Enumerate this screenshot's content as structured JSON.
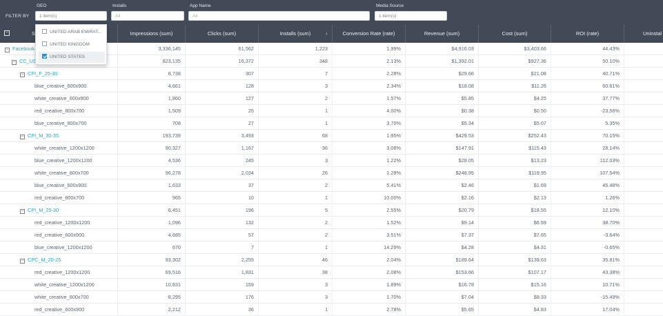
{
  "filter_bar": {
    "label": "FILTER BY",
    "filters": [
      {
        "title": "GEO",
        "value": "1 item(s)",
        "placeholder": ""
      },
      {
        "title": "Installs",
        "value": "",
        "placeholder": "All"
      },
      {
        "title": "App Name",
        "value": "",
        "placeholder": "All"
      },
      {
        "title": "Media Source",
        "value": "1 item(s)",
        "placeholder": ""
      }
    ]
  },
  "geo_dropdown": {
    "options": [
      {
        "label": "UNITED ARAB EMIRAT...",
        "checked": false
      },
      {
        "label": "UNITED KINGDOM",
        "checked": false
      },
      {
        "label": "UNITED STATES",
        "checked": true
      }
    ]
  },
  "table": {
    "expand_all_icon": "minus-square-icon",
    "sort_icon": "arrow-down-icon",
    "columns": {
      "name": "S",
      "impressions": "Impressions (sum)",
      "clicks": "Clicks (sum)",
      "installs": "Installs (sum)",
      "conv": "Conversion Rate (rate)",
      "revenue": "Revenue (sum)",
      "cost": "Cost (sum)",
      "roi": "ROI (rate)",
      "uninstalls": "Uninstal"
    },
    "rows": [
      {
        "level": 0,
        "group": true,
        "name": "Facebook",
        "impressions": "3,336,145",
        "clicks": "61,562",
        "installs": "1,223",
        "conv": "1.99%",
        "revenue": "$4,916.03",
        "cost": "$3,403.66",
        "roi": "44.43%"
      },
      {
        "level": 1,
        "group": true,
        "name": "CC_US",
        "impressions": "823,135",
        "clicks": "16,372",
        "installs": "348",
        "conv": "2.13%",
        "revenue": "$1,392.01",
        "cost": "$927.36",
        "roi": "50.10%"
      },
      {
        "level": 2,
        "group": true,
        "name": "CPI_F_25-30",
        "impressions": "8,738",
        "clicks": "307",
        "installs": "7",
        "conv": "2.28%",
        "revenue": "$29.66",
        "cost": "$21.08",
        "roi": "40.71%"
      },
      {
        "level": 3,
        "group": false,
        "name": "blue_creative_600x900",
        "impressions": "4,661",
        "clicks": "128",
        "installs": "3",
        "conv": "2.34%",
        "revenue": "$18.08",
        "cost": "$11.26",
        "roi": "60.61%"
      },
      {
        "level": 3,
        "group": false,
        "name": "white_creative_600x900",
        "impressions": "1,860",
        "clicks": "127",
        "installs": "2",
        "conv": "1.57%",
        "revenue": "$5.85",
        "cost": "$4.25",
        "roi": "37.77%"
      },
      {
        "level": 3,
        "group": false,
        "name": "red_creative_800x700",
        "impressions": "1,509",
        "clicks": "25",
        "installs": "1",
        "conv": "4.00%",
        "revenue": "$0.38",
        "cost": "$0.50",
        "roi": "-23.56%"
      },
      {
        "level": 3,
        "group": false,
        "name": "blue_creative_800x700",
        "impressions": "708",
        "clicks": "27",
        "installs": "1",
        "conv": "3.70%",
        "revenue": "$5.34",
        "cost": "$5.07",
        "roi": "5.35%"
      },
      {
        "level": 2,
        "group": true,
        "name": "CPI_M_30-35",
        "impressions": "193,739",
        "clicks": "3,493",
        "installs": "68",
        "conv": "1.95%",
        "revenue": "$429.53",
        "cost": "$252.43",
        "roi": "70.15%"
      },
      {
        "level": 3,
        "group": false,
        "name": "white_creative_1200x1200",
        "impressions": "90,327",
        "clicks": "1,167",
        "installs": "36",
        "conv": "3.08%",
        "revenue": "$147.91",
        "cost": "$115.43",
        "roi": "28.14%"
      },
      {
        "level": 3,
        "group": false,
        "name": "blue_creative_1200x1200",
        "impressions": "4,536",
        "clicks": "245",
        "installs": "3",
        "conv": "1.22%",
        "revenue": "$28.05",
        "cost": "$13.23",
        "roi": "112.03%"
      },
      {
        "level": 3,
        "group": false,
        "name": "white_creative_800x700",
        "impressions": "96,278",
        "clicks": "2,034",
        "installs": "26",
        "conv": "1.28%",
        "revenue": "$248.95",
        "cost": "$119.95",
        "roi": "107.54%"
      },
      {
        "level": 3,
        "group": false,
        "name": "blue_creative_600x900",
        "impressions": "1,633",
        "clicks": "37",
        "installs": "2",
        "conv": "5.41%",
        "revenue": "$2.46",
        "cost": "$1.69",
        "roi": "45.48%"
      },
      {
        "level": 3,
        "group": false,
        "name": "red_creative_800x700",
        "impressions": "965",
        "clicks": "10",
        "installs": "1",
        "conv": "10.00%",
        "revenue": "$2.16",
        "cost": "$2.13",
        "roi": "1.26%"
      },
      {
        "level": 2,
        "group": true,
        "name": "CPI_M_25-30",
        "impressions": "6,451",
        "clicks": "196",
        "installs": "5",
        "conv": "2.55%",
        "revenue": "$20.79",
        "cost": "$18.55",
        "roi": "12.10%"
      },
      {
        "level": 3,
        "group": false,
        "name": "red_creative_1200x1200",
        "impressions": "1,096",
        "clicks": "132",
        "installs": "2",
        "conv": "1.52%",
        "revenue": "$9.14",
        "cost": "$6.59",
        "roi": "38.70%"
      },
      {
        "level": 3,
        "group": false,
        "name": "red_creative_600x900",
        "impressions": "4,685",
        "clicks": "57",
        "installs": "2",
        "conv": "3.51%",
        "revenue": "$7.37",
        "cost": "$7.65",
        "roi": "-3.64%"
      },
      {
        "level": 3,
        "group": false,
        "name": "blue_creative_1200x1200",
        "impressions": "670",
        "clicks": "7",
        "installs": "1",
        "conv": "14.29%",
        "revenue": "$4.28",
        "cost": "$4.31",
        "roi": "-0.65%"
      },
      {
        "level": 2,
        "group": true,
        "name": "CPC_M_20-25",
        "impressions": "93,302",
        "clicks": "2,255",
        "installs": "46",
        "conv": "2.04%",
        "revenue": "$189.64",
        "cost": "$139.63",
        "roi": "35.81%"
      },
      {
        "level": 3,
        "group": false,
        "name": "red_creative_1200x1200",
        "impressions": "69,516",
        "clicks": "1,831",
        "installs": "38",
        "conv": "2.08%",
        "revenue": "$153.66",
        "cost": "$107.17",
        "roi": "43.38%"
      },
      {
        "level": 3,
        "group": false,
        "name": "white_creative_1200x1200",
        "impressions": "10,831",
        "clicks": "159",
        "installs": "3",
        "conv": "1.89%",
        "revenue": "$16.78",
        "cost": "$15.16",
        "roi": "10.71%"
      },
      {
        "level": 3,
        "group": false,
        "name": "white_creative_800x700",
        "impressions": "8,295",
        "clicks": "176",
        "installs": "3",
        "conv": "1.70%",
        "revenue": "$7.04",
        "cost": "$8.33",
        "roi": "-15.49%"
      },
      {
        "level": 3,
        "group": false,
        "name": "red_creative_600x900",
        "impressions": "2,212",
        "clicks": "36",
        "installs": "1",
        "conv": "2.78%",
        "revenue": "$5.65",
        "cost": "$4.83",
        "roi": "17.04%"
      }
    ]
  }
}
